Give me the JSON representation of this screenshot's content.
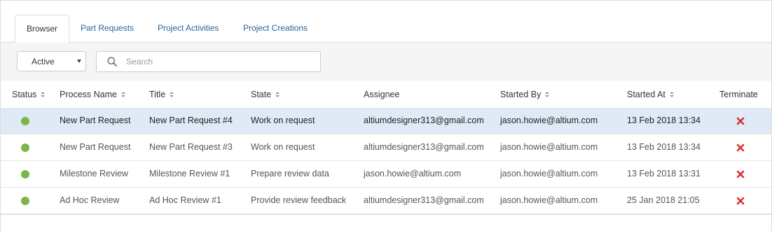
{
  "tabs": [
    {
      "label": "Browser",
      "active": true
    },
    {
      "label": "Part Requests",
      "active": false
    },
    {
      "label": "Project Activities",
      "active": false
    },
    {
      "label": "Project Creations",
      "active": false
    }
  ],
  "filter": {
    "status_value": "Active",
    "search_placeholder": "Search",
    "search_value": ""
  },
  "table": {
    "columns": [
      "Status",
      "Process Name",
      "Title",
      "State",
      "Assignee",
      "Started By",
      "Started At",
      "Terminate"
    ],
    "rows": [
      {
        "status": "active",
        "process_name": "New Part Request",
        "title": "New Part Request #4",
        "state": "Work on request",
        "assignee": "altiumdesigner313@gmail.com",
        "started_by": "jason.howie@altium.com",
        "started_at": "13 Feb 2018 13:34",
        "selected": true
      },
      {
        "status": "active",
        "process_name": "New Part Request",
        "title": "New Part Request #3",
        "state": "Work on request",
        "assignee": "altiumdesigner313@gmail.com",
        "started_by": "jason.howie@altium.com",
        "started_at": "13 Feb 2018 13:34",
        "selected": false
      },
      {
        "status": "active",
        "process_name": "Milestone Review",
        "title": "Milestone Review #1",
        "state": "Prepare review data",
        "assignee": "jason.howie@altium.com",
        "started_by": "jason.howie@altium.com",
        "started_at": "13 Feb 2018 13:31",
        "selected": false
      },
      {
        "status": "active",
        "process_name": "Ad Hoc Review",
        "title": "Ad Hoc Review #1",
        "state": "Provide review feedback",
        "assignee": "altiumdesigner313@gmail.com",
        "started_by": "jason.howie@altium.com",
        "started_at": "25 Jan 2018 21:05",
        "selected": false
      }
    ]
  },
  "colors": {
    "link": "#2a6496",
    "status_active": "#7ab648",
    "terminate": "#d9312b",
    "selected_row": "#dfeaf6"
  },
  "icons": {
    "search": "search-icon",
    "terminate": "close-icon",
    "status": "status-dot-icon"
  }
}
